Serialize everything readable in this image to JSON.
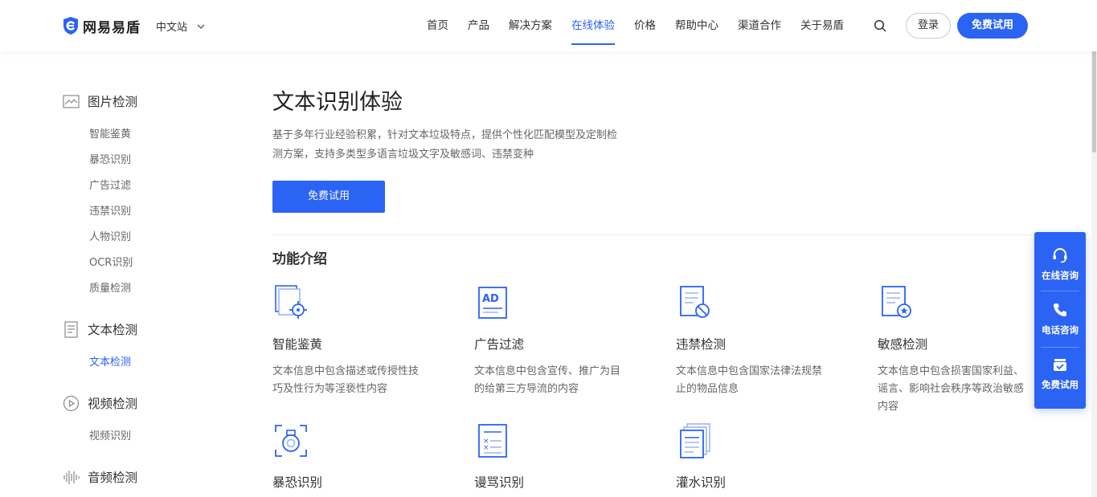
{
  "brand": {
    "name": "网易易盾",
    "color": "#2b63f5"
  },
  "header": {
    "site_switch": "中文站",
    "nav": [
      "首页",
      "产品",
      "解决方案",
      "在线体验",
      "价格",
      "帮助中心",
      "渠道合作",
      "关于易盾"
    ],
    "active_nav": "在线体验",
    "login_label": "登录",
    "trial_label": "免费试用"
  },
  "sidebar": {
    "groups": [
      {
        "label": "图片检测",
        "icon": "image-icon",
        "items": [
          "智能鉴黄",
          "暴恐识别",
          "广告过滤",
          "违禁识别",
          "人物识别",
          "OCR识别",
          "质量检测"
        ]
      },
      {
        "label": "文本检测",
        "icon": "document-icon",
        "items": [
          "文本检测"
        ],
        "active_item": "文本检测"
      },
      {
        "label": "视频检测",
        "icon": "play-icon",
        "items": [
          "视频识别"
        ]
      },
      {
        "label": "音频检测",
        "icon": "audio-wave-icon",
        "items": []
      }
    ]
  },
  "main": {
    "title": "文本识别体验",
    "description": "基于多年行业经验积累，针对文本垃圾特点，提供个性化匹配模型及定制检测方案，支持多类型多语言垃圾文字及敏感词、违禁变种",
    "cta_label": "免费试用",
    "section_title": "功能介绍",
    "features": [
      {
        "name": "智能鉴黄",
        "desc": "文本信息中包含描述或传授性技巧及性行为等淫亵性内容",
        "icon": "target-document-icon"
      },
      {
        "name": "广告过滤",
        "desc": "文本信息中包含宣传、推广为目的给第三方导流的内容",
        "icon": "ad-icon"
      },
      {
        "name": "违禁检测",
        "desc": "文本信息中包含国家法律法规禁止的物品信息",
        "icon": "prohibited-document-icon"
      },
      {
        "name": "敏感检测",
        "desc": "文本信息中包含损害国家利益、谣言、影响社会秩序等政治敏感内容",
        "icon": "star-document-icon"
      },
      {
        "name": "暴恐识别",
        "desc": "",
        "icon": "bomb-icon"
      },
      {
        "name": "谩骂识别",
        "desc": "",
        "icon": "checklist-icon"
      },
      {
        "name": "灌水识别",
        "desc": "",
        "icon": "stacked-documents-icon"
      }
    ]
  },
  "float_panel": {
    "items": [
      {
        "label": "在线咨询",
        "icon": "headset-icon"
      },
      {
        "label": "电话咨询",
        "icon": "phone-icon"
      },
      {
        "label": "免费试用",
        "icon": "gift-icon"
      }
    ]
  }
}
